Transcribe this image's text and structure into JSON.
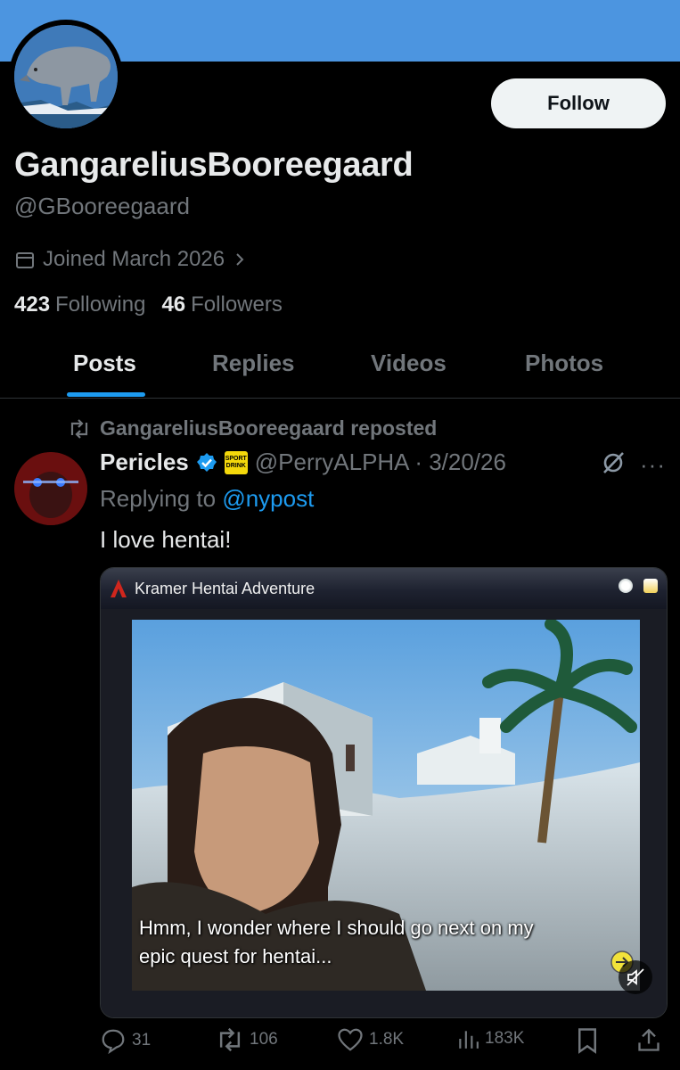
{
  "profile": {
    "display_name": "GangareliusBooreegaard",
    "handle": "@GBooreegaard",
    "joined": "Joined March 2026",
    "following_count": "423",
    "following_label": "Following",
    "followers_count": "46",
    "followers_label": "Followers",
    "follow_label": "Follow"
  },
  "tabs": [
    {
      "label": "Posts",
      "active": true
    },
    {
      "label": "Replies",
      "active": false
    },
    {
      "label": "Videos",
      "active": false
    },
    {
      "label": "Photos",
      "active": false
    }
  ],
  "post": {
    "repost_label": "GangareliusBooreegaard reposted",
    "author": "Pericles",
    "affiliate_badge": "SPORT DRINK",
    "handle_date": "@PerryALPHA · 3/20/26",
    "replying_prefix": "Replying to",
    "replying_handle": "@nypost",
    "text": "I love hentai!",
    "media": {
      "window_title": "Kramer Hentai Adventure",
      "caption_line1": "Hmm, I wonder where I should go next on my",
      "caption_line2": "epic quest for hentai..."
    },
    "stats": {
      "replies": "31",
      "reposts": "106",
      "likes": "1.8K",
      "views": "183K"
    }
  },
  "colors": {
    "banner": "#4c95e0",
    "accent": "#1d9bf0",
    "muted": "#71767b",
    "text": "#e7e9ea"
  }
}
